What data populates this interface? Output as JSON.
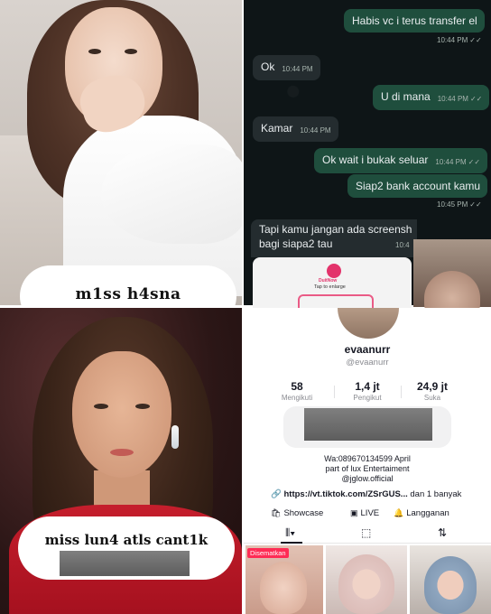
{
  "collage": {
    "top_left": {
      "caption": "m1ss h4sna"
    },
    "top_right_chat": {
      "messages": [
        {
          "text": "Habis vc i terus transfer el",
          "time": "10:44 PM",
          "side": "out"
        },
        {
          "text": "Ok",
          "time": "10:44 PM",
          "side": "in"
        },
        {
          "text": "U di mana",
          "time": "10:44 PM",
          "side": "out"
        },
        {
          "text": "Kamar",
          "time": "10:44 PM",
          "side": "in"
        },
        {
          "text": "Ok wait i bukak seluar",
          "time": "10:44 PM",
          "side": "out"
        },
        {
          "text": "Siap2 bank account kamu",
          "time": "10:45 PM",
          "side": "out"
        }
      ],
      "long_message_line1": "Tapi kamu jangan ada screensh",
      "long_message_line2": "bagi siapa2 tau",
      "long_message_time": "10:4",
      "attachment_brand": "DuitNow",
      "attachment_hint": "Tap to enlarge"
    },
    "bottom_left": {
      "caption": "miss lun4 atls cant1k"
    },
    "bottom_right_profile": {
      "display_name": "evaanurr",
      "handle": "@evaanurr",
      "stats": [
        {
          "value": "58",
          "label": "Mengikuti"
        },
        {
          "value": "1,4 jt",
          "label": "Pengikut"
        },
        {
          "value": "24,9 jt",
          "label": "Suka"
        }
      ],
      "bio_line1": "Wa:089670134599 April",
      "bio_line2": "part of lux Entertaiment",
      "bio_line3": "@jglow.official",
      "link_text": "https://vt.tiktok.com/ZSrGUS...",
      "link_more": " dan 1 banyak",
      "actions": [
        "Showcase",
        "LIVE",
        "Langganan"
      ],
      "pinned_label": "Disematkan"
    }
  },
  "colors": {
    "chat_out_bubble": "#1f4e3d",
    "chat_in_bubble": "#242c2f",
    "chat_bg": "#0e1517",
    "tiktok_pin": "#fe2c55",
    "dress_red": "#c51e2c"
  },
  "icons": [
    "link-icon",
    "shop-icon",
    "live-icon",
    "bell-icon",
    "grid-icon",
    "bag-icon",
    "repost-icon",
    "double-check-icon"
  ]
}
